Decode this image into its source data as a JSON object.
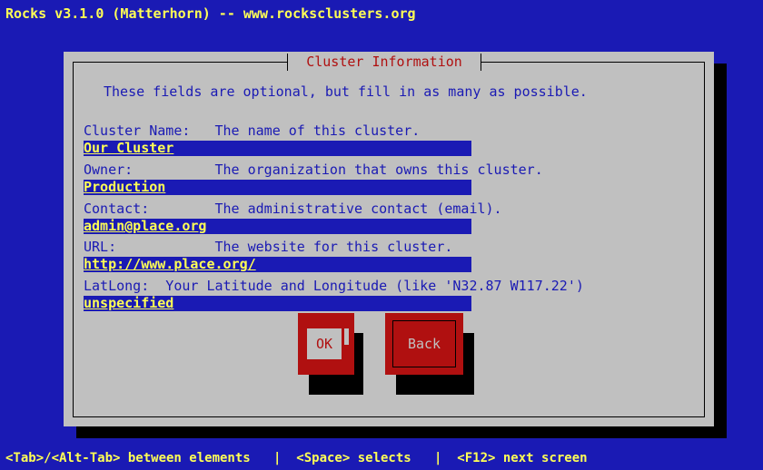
{
  "header": {
    "title": "Rocks v3.1.0 (Matterhorn) -- www.rocksclusters.org"
  },
  "dialog": {
    "title": "Cluster Information",
    "intro": "These fields are optional, but fill in as many as possible.",
    "fields": [
      {
        "label": "Cluster Name:   The name of this cluster.",
        "value": "Our Cluster"
      },
      {
        "label": "Owner:          The organization that owns this cluster.",
        "value": "Production"
      },
      {
        "label": "Contact:        The administrative contact (email).",
        "value": "admin@place.org"
      },
      {
        "label": "URL:            The website for this cluster.",
        "value": "http://www.place.org/"
      },
      {
        "label": "LatLong:  Your Latitude and Longitude (like 'N32.87 W117.22')",
        "value": "unspecified"
      }
    ],
    "buttons": {
      "ok": "OK",
      "back": "Back"
    }
  },
  "statusbar": {
    "text": "<Tab>/<Alt-Tab> between elements   |  <Space> selects   |  <F12> next screen"
  },
  "colors": {
    "background": "#1a1ab4",
    "dialog": "#c0c0c0",
    "accent": "#b01010",
    "highlight": "#ffff55"
  }
}
